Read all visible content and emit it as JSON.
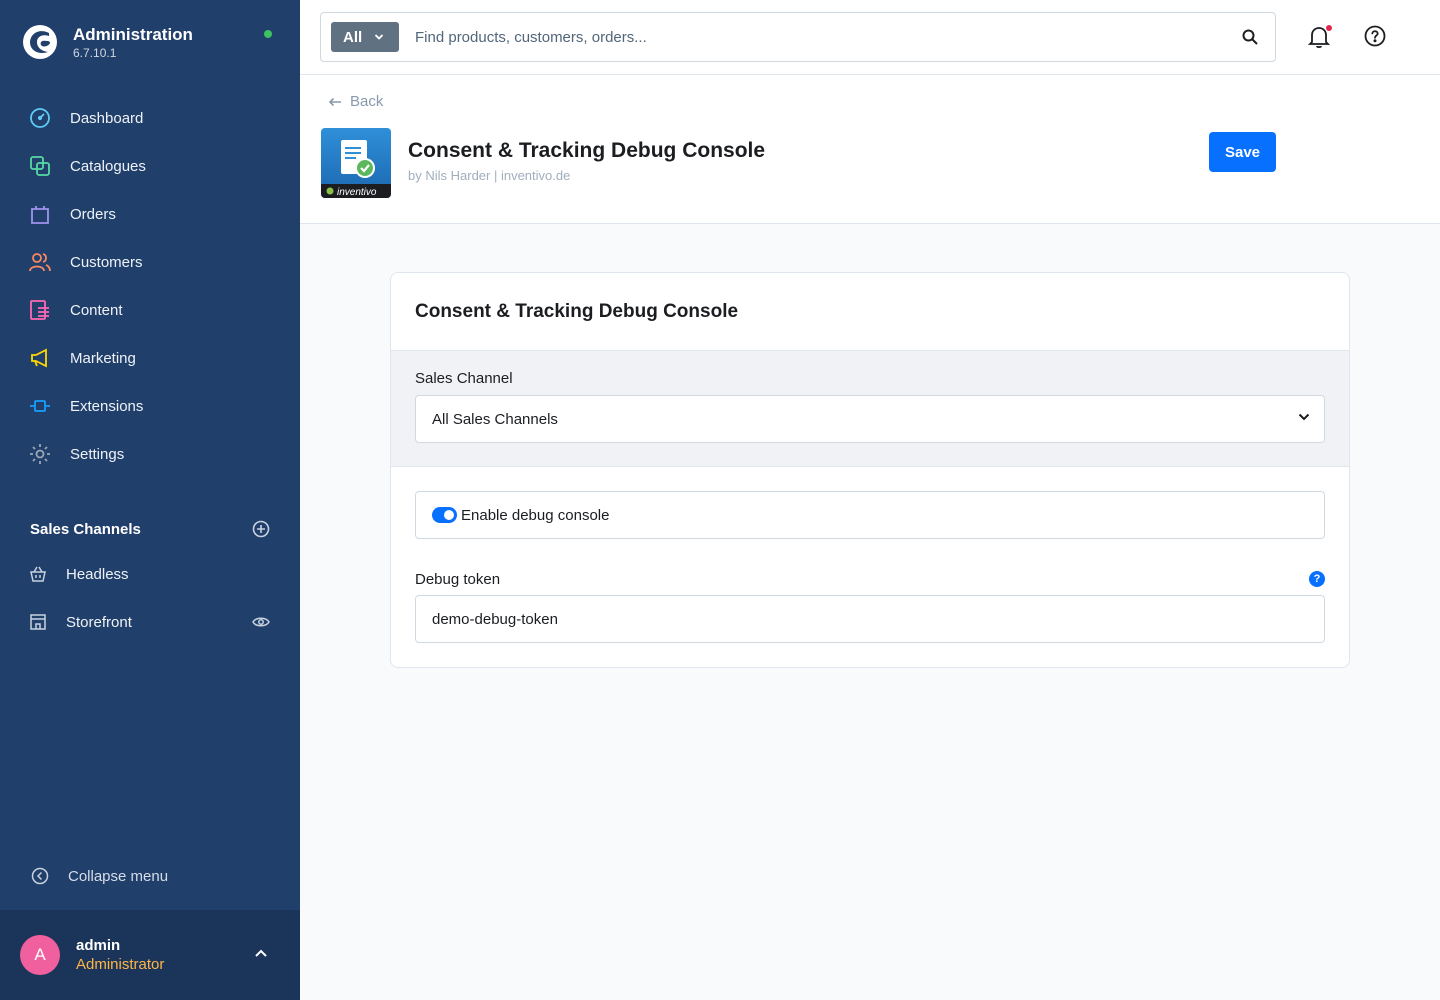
{
  "colors": {
    "sidebar_bg": "#213f6b",
    "accent": "#0870ff",
    "status_online": "#3cc261",
    "user_role": "#ffb547",
    "avatar_bg": "#f0609e"
  },
  "sidebar": {
    "brand_title": "Administration",
    "brand_version": "6.7.10.1",
    "nav_items": [
      {
        "label": "Dashboard",
        "icon": "dashboard-icon"
      },
      {
        "label": "Catalogues",
        "icon": "catalogues-icon"
      },
      {
        "label": "Orders",
        "icon": "orders-icon"
      },
      {
        "label": "Customers",
        "icon": "customers-icon"
      },
      {
        "label": "Content",
        "icon": "content-icon"
      },
      {
        "label": "Marketing",
        "icon": "marketing-icon"
      },
      {
        "label": "Extensions",
        "icon": "extensions-icon"
      },
      {
        "label": "Settings",
        "icon": "settings-icon"
      }
    ],
    "sales_channels_heading": "Sales Channels",
    "sales_channels": [
      {
        "label": "Headless",
        "icon": "basket-icon"
      },
      {
        "label": "Storefront",
        "icon": "storefront-icon"
      }
    ],
    "collapse_label": "Collapse menu",
    "user": {
      "initial": "A",
      "name": "admin",
      "role": "Administrator"
    }
  },
  "topbar": {
    "search_type": "All",
    "search_placeholder": "Find products, customers, orders..."
  },
  "header": {
    "back_label": "Back",
    "plugin_title": "Consent & Tracking Debug Console",
    "plugin_sub": "by Nils Harder | inventivo.de",
    "plugin_logo_text": "inventivo",
    "save_label": "Save"
  },
  "card": {
    "title": "Consent & Tracking Debug Console",
    "sales_channel_label": "Sales Channel",
    "sales_channel_value": "All Sales Channels",
    "toggle_label": "Enable debug console",
    "toggle_on": true,
    "token_label": "Debug token",
    "token_value": "demo-debug-token"
  }
}
